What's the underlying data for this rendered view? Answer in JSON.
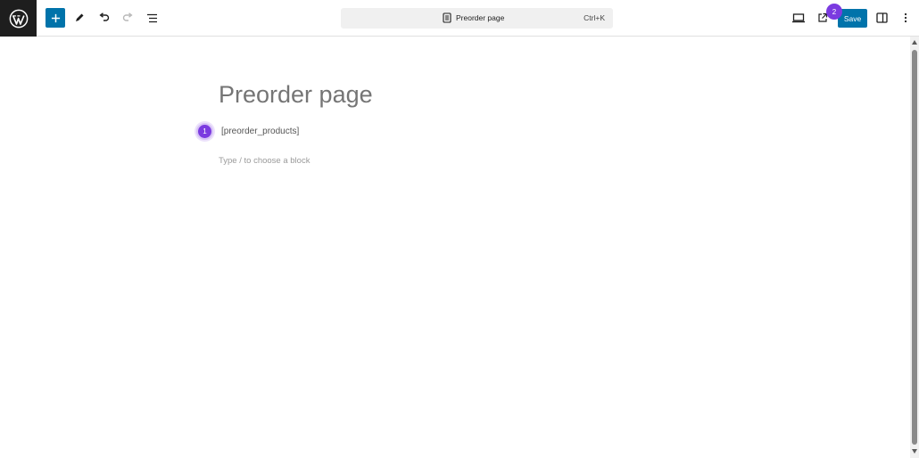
{
  "toolbar": {
    "logo_icon": "wordpress-logo-icon",
    "add_block_icon": "plus-icon",
    "tools_icon": "pencil-icon",
    "undo_icon": "undo-icon",
    "redo_icon": "redo-icon",
    "outline_icon": "list-view-icon",
    "command_bar": {
      "title": "Preorder page",
      "shortcut": "Ctrl+K"
    },
    "preview_icon": "desktop-icon",
    "view_page_icon": "external-link-icon",
    "save_label": "Save",
    "settings_icon": "sidebar-icon",
    "options_icon": "more-vertical-icon"
  },
  "badges": {
    "one": "1",
    "two": "2",
    "color": "#7b3be0"
  },
  "editor": {
    "title": "Preorder page",
    "shortcode": "[preorder_products]",
    "block_placeholder": "Type / to choose a block"
  },
  "colors": {
    "accent": "#0073aa",
    "badge": "#7b3be0",
    "logo_bg": "#1e1e1e"
  }
}
